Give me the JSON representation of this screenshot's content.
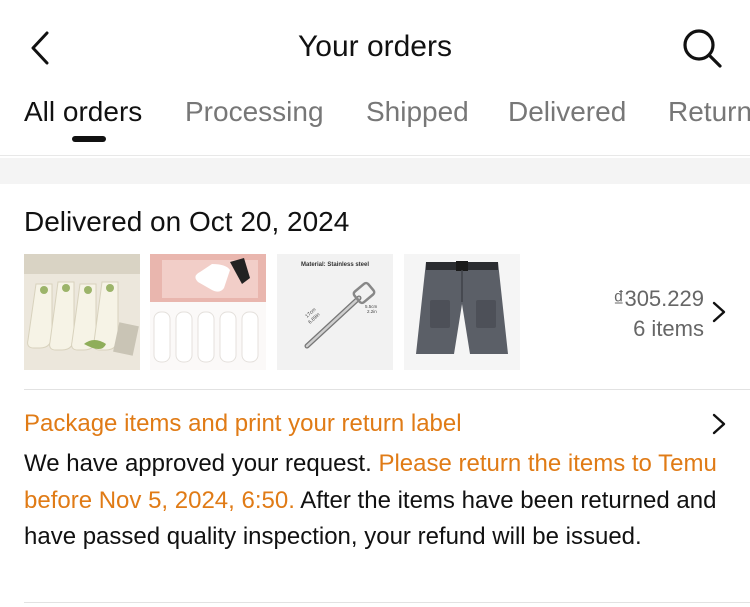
{
  "header": {
    "title": "Your orders",
    "back_icon": "chevron-left-icon",
    "search_icon": "search-icon"
  },
  "tabs": [
    {
      "label": "All orders",
      "active": true
    },
    {
      "label": "Processing",
      "active": false
    },
    {
      "label": "Shipped",
      "active": false
    },
    {
      "label": "Delivered",
      "active": false
    },
    {
      "label": "Returns",
      "active": false
    }
  ],
  "order": {
    "delivered_heading": "Delivered on Oct 20, 2024",
    "price": "₫305.229",
    "item_count": "6 items",
    "thumbnails": [
      {
        "name": "lace-socks-thumbnail"
      },
      {
        "name": "white-socks-thumbnail"
      },
      {
        "name": "peeler-thumbnail",
        "caption": "Material: Stainless steel",
        "dim_left_1": "17cm",
        "dim_left_2": "6.69in",
        "dim_right_1": "5.5cm",
        "dim_right_2": "2.2in"
      },
      {
        "name": "cargo-shorts-thumbnail"
      }
    ]
  },
  "return_notice": {
    "title": "Package items and print your return label",
    "msg_start": "We have approved your request. ",
    "msg_highlight": "Please return the items to Temu before Nov 5, 2024, 6:50.",
    "msg_end": " After the items have been returned and have passed quality inspection, your refund will be issued."
  },
  "colors": {
    "accent_orange": "#e07b16",
    "text_primary": "#111111",
    "text_secondary": "#666666",
    "band": "#f4f4f4"
  }
}
